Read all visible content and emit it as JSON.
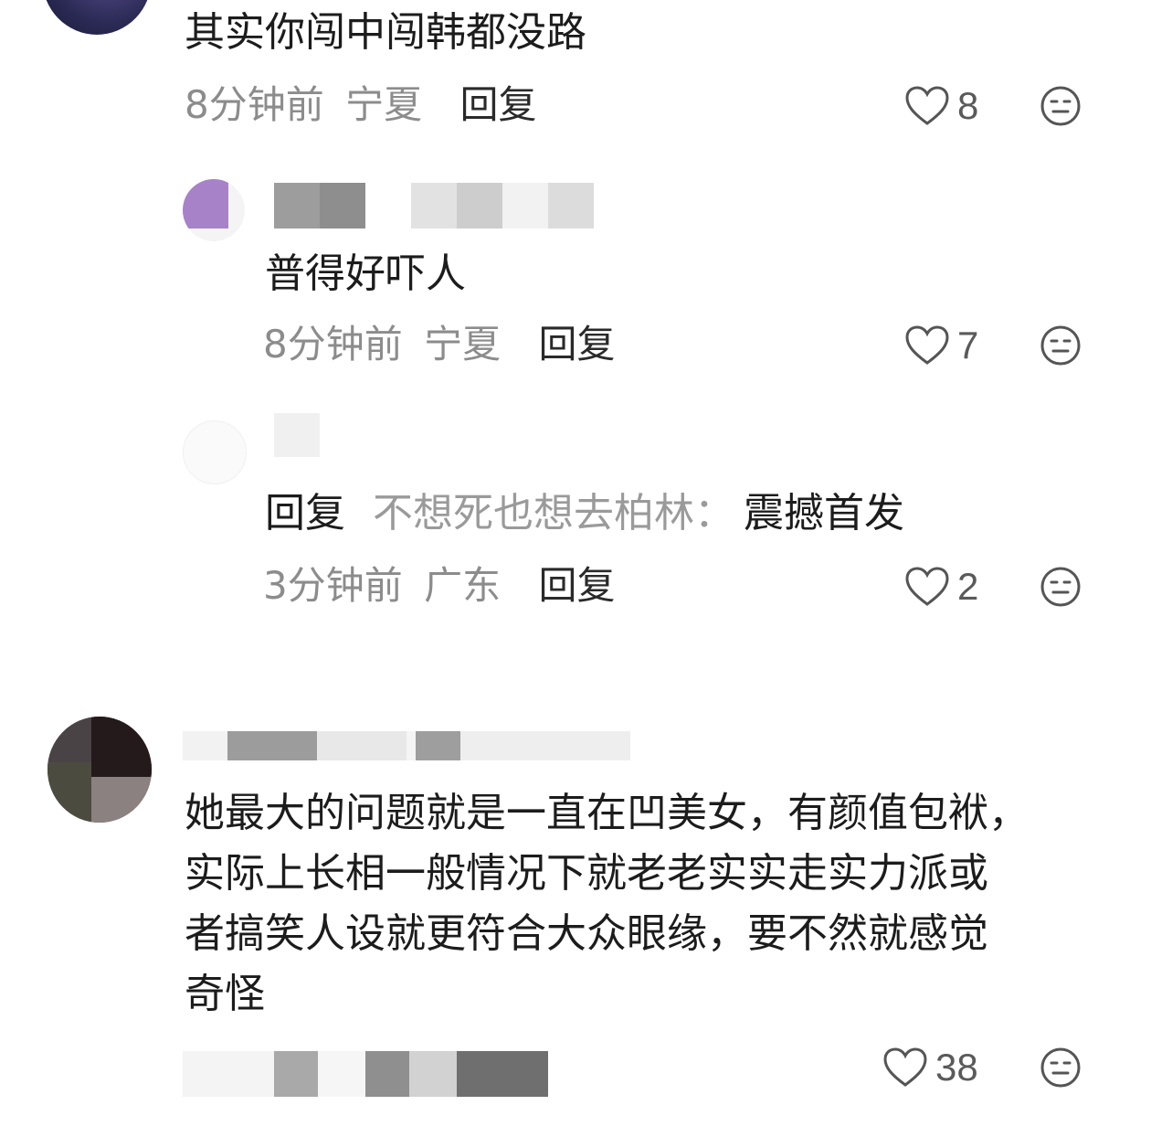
{
  "comments": [
    {
      "text": "其实你闯中闯韩都没路",
      "time": "8分钟前",
      "location": "宁夏",
      "reply_label": "回复",
      "likes": "8"
    },
    {
      "text": "普得好吓人",
      "time": "8分钟前",
      "location": "宁夏",
      "reply_label": "回复",
      "likes": "7"
    },
    {
      "reply_prefix": "回复",
      "reply_target": "不想死也想去柏林：",
      "text": "震撼首发",
      "time": "3分钟前",
      "location": "广东",
      "reply_label": "回复",
      "likes": "2"
    },
    {
      "lines": [
        "她最大的问题就是一直在凹美女，有颜值包袱，",
        "实际上长相一般情况下就老老实实走实力派或",
        "者搞笑人设就更符合大众眼缘，要不然就感觉",
        "奇怪"
      ],
      "likes": "38"
    }
  ],
  "icons": {
    "like": "heart-outline-icon",
    "react": "neutral-face-icon"
  },
  "colors": {
    "text": "#1c1c1c",
    "meta": "#8c8c8c",
    "icon": "#555555"
  }
}
